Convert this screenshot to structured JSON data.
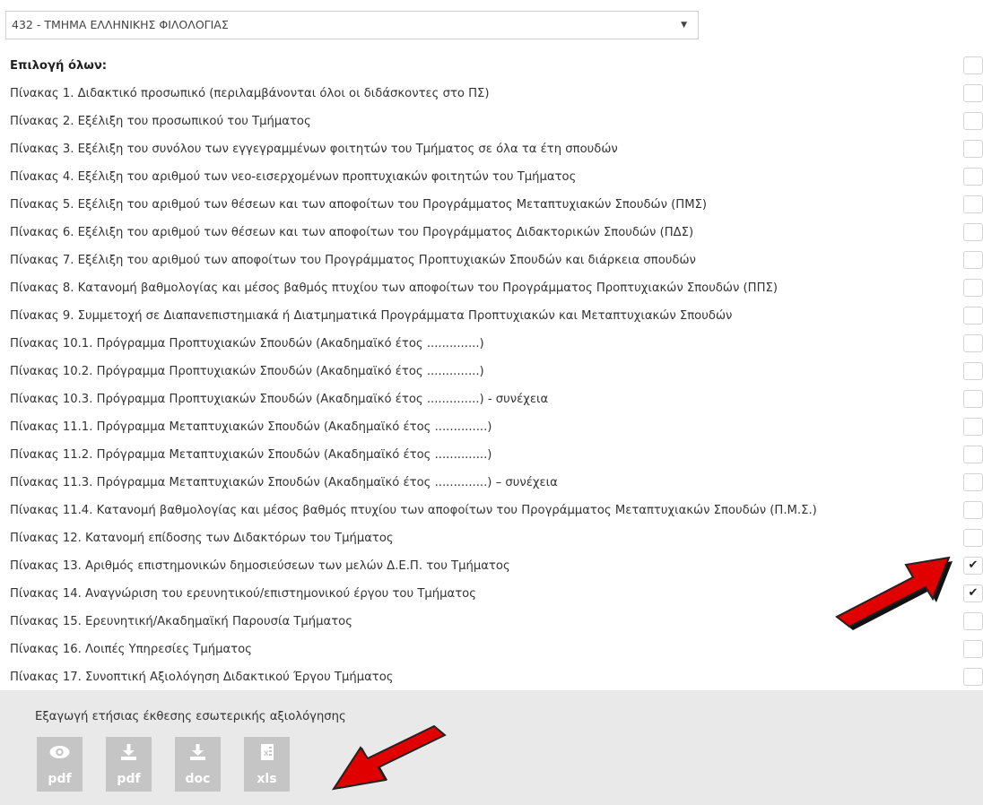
{
  "department_select": {
    "value": "432 - ΤΜΗΜΑ ΕΛΛΗΝΙΚΗΣ ΦΙΛΟΛΟΓΙΑΣ"
  },
  "select_all_label": "Επιλογή όλων:",
  "tables": [
    {
      "label": "Πίνακας 1. Διδακτικό προσωπικό (περιλαμβάνονται όλοι οι διδάσκοντες στο ΠΣ)",
      "checked": false
    },
    {
      "label": "Πίνακας 2. Εξέλιξη του προσωπικού του Τμήματος",
      "checked": false
    },
    {
      "label": "Πίνακας 3. Εξέλιξη του συνόλου των εγγεγραμμένων φοιτητών του Τμήματος σε όλα τα έτη σπουδών",
      "checked": false
    },
    {
      "label": "Πίνακας 4. Εξέλιξη του αριθμού των νεο-εισερχομένων προπτυχιακών φοιτητών του Τμήματος",
      "checked": false
    },
    {
      "label": "Πίνακας 5. Εξέλιξη του αριθμού των θέσεων και των αποφοίτων του Προγράμματος Μεταπτυχιακών Σπουδών (ΠΜΣ)",
      "checked": false
    },
    {
      "label": "Πίνακας 6. Εξέλιξη του αριθμού των θέσεων και των αποφοίτων του Προγράμματος Διδακτορικών Σπουδών (ΠΔΣ)",
      "checked": false
    },
    {
      "label": "Πίνακας 7. Εξέλιξη του αριθμού των αποφοίτων του Προγράμματος Προπτυχιακών Σπουδών και διάρκεια σπουδών",
      "checked": false
    },
    {
      "label": "Πίνακας 8. Κατανομή βαθμολογίας και μέσος βαθμός πτυχίου των αποφοίτων του Προγράμματος Προπτυχιακών Σπουδών (ΠΠΣ)",
      "checked": false
    },
    {
      "label": "Πίνακας 9. Συμμετοχή σε Διαπανεπιστημιακά ή Διατμηματικά Προγράμματα Προπτυχιακών και Μεταπτυχιακών Σπουδών",
      "checked": false
    },
    {
      "label": "Πίνακας 10.1. Πρόγραμμα Προπτυχιακών Σπουδών (Ακαδημαϊκό έτος ..............)",
      "checked": false
    },
    {
      "label": "Πίνακας 10.2. Πρόγραμμα Προπτυχιακών Σπουδών (Ακαδημαϊκό έτος ..............)",
      "checked": false
    },
    {
      "label": "Πίνακας 10.3. Πρόγραμμα Προπτυχιακών Σπουδών (Ακαδημαϊκό έτος ..............) - συνέχεια",
      "checked": false
    },
    {
      "label": "Πίνακας 11.1. Πρόγραμμα Μεταπτυχιακών Σπουδών (Ακαδημαϊκό έτος ..............)",
      "checked": false
    },
    {
      "label": "Πίνακας 11.2. Πρόγραμμα Μεταπτυχιακών Σπουδών (Ακαδημαϊκό έτος ..............)",
      "checked": false
    },
    {
      "label": "Πίνακας 11.3. Πρόγραμμα Μεταπτυχιακών Σπουδών (Ακαδημαϊκό έτος ..............) – συνέχεια",
      "checked": false
    },
    {
      "label": "Πίνακας 11.4. Κατανομή βαθμολογίας και μέσος βαθμός πτυχίου των αποφοίτων του Προγράμματος Μεταπτυχιακών Σπουδών (Π.Μ.Σ.)",
      "checked": false
    },
    {
      "label": "Πίνακας 12. Κατανομή επίδοσης των Διδακτόρων του Τμήματος",
      "checked": false
    },
    {
      "label": "Πίνακας 13. Αριθμός επιστημονικών δημοσιεύσεων των μελών Δ.Ε.Π. του Τμήματος",
      "checked": true
    },
    {
      "label": "Πίνακας 14. Αναγνώριση του ερευνητικού/επιστημονικού έργου του Τμήματος",
      "checked": true
    },
    {
      "label": "Πίνακας 15. Ερευνητική/Ακαδημαϊκή Παρουσία Τμήματος",
      "checked": false
    },
    {
      "label": "Πίνακας 16. Λοιπές Υπηρεσίες Τμήματος",
      "checked": false
    },
    {
      "label": "Πίνακας 17. Συνοπτική Αξιολόγηση Διδακτικού Έργου Τμήματος",
      "checked": false
    }
  ],
  "export": {
    "title": "Εξαγωγή ετήσιας έκθεσης εσωτερικής αξιολόγησης",
    "buttons": [
      {
        "label": "pdf",
        "icon": "eye-icon"
      },
      {
        "label": "pdf",
        "icon": "download-icon"
      },
      {
        "label": "doc",
        "icon": "download-icon"
      },
      {
        "label": "xls",
        "icon": "excel-icon"
      }
    ]
  },
  "colors": {
    "arrow_fill": "#e00000",
    "button_bg": "#c5c5c5",
    "panel_bg": "#e9e9e9"
  }
}
